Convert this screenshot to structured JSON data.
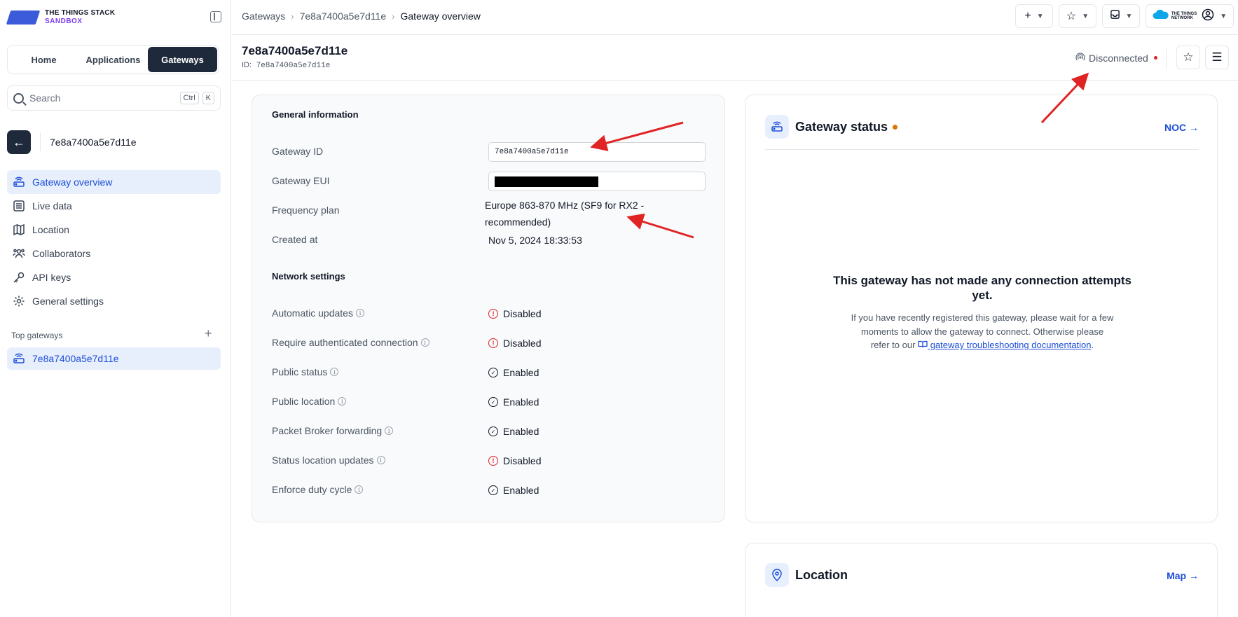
{
  "sidebar": {
    "logo_line1": "THE THINGS STACK",
    "logo_line2": "SANDBOX",
    "tabs": [
      {
        "label": "Home"
      },
      {
        "label": "Applications"
      },
      {
        "label": "Gateways"
      }
    ],
    "search": {
      "placeholder": "Search",
      "shortcut_ctrl": "Ctrl",
      "shortcut_key": "K"
    },
    "back_name": "7e8a7400a5e7d11e",
    "nav": [
      {
        "label": "Gateway overview",
        "icon": "gateway-icon",
        "active": true
      },
      {
        "label": "Live data",
        "icon": "list-icon"
      },
      {
        "label": "Location",
        "icon": "map-icon"
      },
      {
        "label": "Collaborators",
        "icon": "users-icon"
      },
      {
        "label": "API keys",
        "icon": "key-icon"
      },
      {
        "label": "General settings",
        "icon": "gear-icon"
      }
    ],
    "top_gateways_label": "Top gateways",
    "top_gateway_item": "7e8a7400a5e7d11e"
  },
  "topbar": {
    "breadcrumbs": [
      "Gateways",
      "7e8a7400a5e7d11e",
      "Gateway overview"
    ]
  },
  "header": {
    "title": "7e8a7400a5e7d11e",
    "id_label": "ID:",
    "id_value": "7e8a7400a5e7d11e",
    "status": "Disconnected"
  },
  "general": {
    "heading": "General information",
    "gateway_id_label": "Gateway ID",
    "gateway_id_value": "7e8a7400a5e7d11e",
    "gateway_eui_label": "Gateway EUI",
    "frequency_plan_label": "Frequency plan",
    "frequency_plan_line1": "Europe 863-870 MHz (SF9 for RX2 -",
    "frequency_plan_line2": "recommended)",
    "created_at_label": "Created at",
    "created_at_value": "Nov 5, 2024 18:33:53"
  },
  "network": {
    "heading": "Network settings",
    "rows": [
      {
        "label": "Automatic updates",
        "value": "Disabled",
        "enabled": false
      },
      {
        "label": "Require authenticated connection",
        "value": "Disabled",
        "enabled": false
      },
      {
        "label": "Public status",
        "value": "Enabled",
        "enabled": true
      },
      {
        "label": "Public location",
        "value": "Enabled",
        "enabled": true
      },
      {
        "label": "Packet Broker forwarding",
        "value": "Enabled",
        "enabled": true
      },
      {
        "label": "Status location updates",
        "value": "Disabled",
        "enabled": false
      },
      {
        "label": "Enforce duty cycle",
        "value": "Enabled",
        "enabled": true
      }
    ]
  },
  "gateway_status": {
    "title": "Gateway status",
    "link": "NOC →",
    "empty_title": "This gateway has not made any connection attempts yet.",
    "empty_desc_1": "If you have recently registered this gateway, please wait for a few moments to allow the gateway to connect. Otherwise please refer to our",
    "empty_link": "gateway troubleshooting documentation",
    "empty_desc_2": "."
  },
  "location_card": {
    "title": "Location",
    "link": "Map →"
  },
  "colors": {
    "accent": "#1d4ed8",
    "dark": "#1e293b",
    "disconnected": "#dc2626",
    "status_dot": "#d97706",
    "annotation": "#e02424"
  }
}
